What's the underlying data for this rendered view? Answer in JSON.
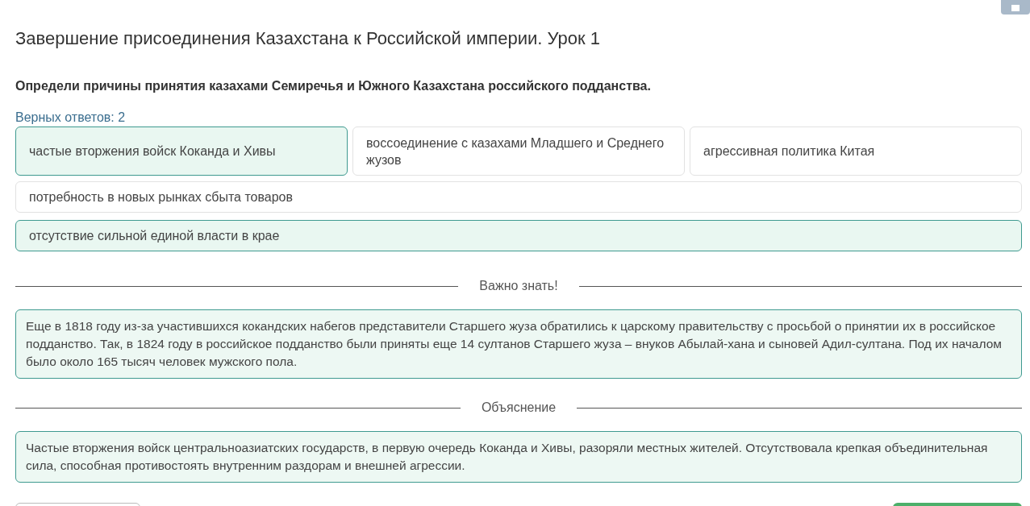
{
  "title": "Завершение присоединения Казахстана к Российской империи. Урок 1",
  "question": "Определи причины принятия казахами Семиречья и Южного Казахстана российского подданства.",
  "correct_count": "Верных ответов: 2",
  "options": [
    {
      "label": "частые вторжения войск Коканда и Хивы",
      "selected": true
    },
    {
      "label": "воссоединение с казахами Младшего и Среднего жузов",
      "selected": false
    },
    {
      "label": "агрессивная политика Китая",
      "selected": false
    },
    {
      "label": "потребность в новых рынках сбыта товаров",
      "selected": false
    },
    {
      "label": "отсутствие сильной единой власти в крае",
      "selected": true
    }
  ],
  "sections": [
    {
      "heading": "Важно знать!",
      "text": "Еще в 1818 году из-за участившихся кокандских набегов представители Старшего жуза обратились к царскому правительству с просьбой о принятии их в российское подданство. Так, в 1824 году в российское подданство были приняты еще 14 султанов Старшего жуза – внуков Абылай-хана и сыновей Адил-султана. Под их началом было около 165 тысяч человек мужского пола."
    },
    {
      "heading": "Объяснение",
      "text": "Частые вторжения войск центральноазиатских государств, в первую очередь Коканда и Хивы, разоряли местных жителей. Отсутствовала крепкая объединительная сила, способная противостоять внутренним раздорам и внешней агрессии."
    }
  ]
}
